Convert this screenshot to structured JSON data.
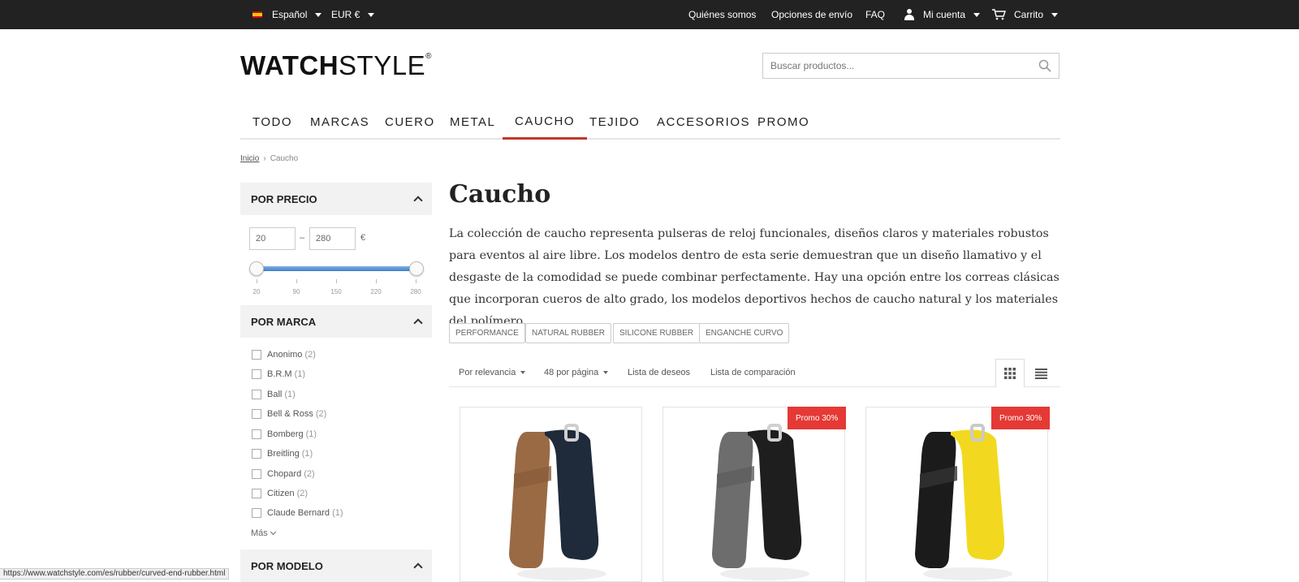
{
  "topbar": {
    "language": "Español",
    "currency": "EUR €",
    "links": [
      "Quiénes somos",
      "Opciones de envío",
      "FAQ"
    ],
    "account": "Mi cuenta",
    "cart": "Carrito"
  },
  "header": {
    "logo_bold": "WATCH",
    "logo_light": "STYLE",
    "logo_mark": "®",
    "search_placeholder": "Buscar productos..."
  },
  "nav": {
    "tabs": [
      "TODO",
      "MARCAS",
      "CUERO",
      "METAL",
      "CAUCHO",
      "TEJIDO",
      "ACCESORIOS",
      "PROMO"
    ],
    "active": "CAUCHO"
  },
  "breadcrumb": {
    "home": "Inicio",
    "separator": "›",
    "current": "Caucho"
  },
  "sidebar": {
    "price": {
      "title": "POR PRECIO",
      "min": "20",
      "max": "280",
      "dash": "–",
      "currency": "€",
      "ticks": [
        "20",
        "90",
        "150",
        "220",
        "280"
      ]
    },
    "brand": {
      "title": "POR MARCA",
      "items": [
        {
          "name": "Anonimo",
          "count": "(2)"
        },
        {
          "name": "B.R.M",
          "count": "(1)"
        },
        {
          "name": "Ball",
          "count": "(1)"
        },
        {
          "name": "Bell & Ross",
          "count": "(2)"
        },
        {
          "name": "Bomberg",
          "count": "(1)"
        },
        {
          "name": "Breitling",
          "count": "(1)"
        },
        {
          "name": "Chopard",
          "count": "(2)"
        },
        {
          "name": "Citizen",
          "count": "(2)"
        },
        {
          "name": "Claude Bernard",
          "count": "(1)"
        }
      ],
      "more": "Más"
    },
    "model": {
      "title": "POR MODELO"
    }
  },
  "main": {
    "title": "Caucho",
    "description": "La colección de caucho representa pulseras de reloj funcionales, diseños claros y materiales robustos para eventos al aire libre. Los modelos dentro de esta serie demuestran que un diseño llamativo y el desgaste de la comodidad se puede combinar perfectamente. Hay una opción entre los correas clásicas que incorporan cueros de alto grado, los modelos deportivos hechos de caucho natural y los materiales del polímero.",
    "tags": [
      "PERFORMANCE",
      "NATURAL RUBBER",
      "SILICONE RUBBER",
      "ENGANCHE CURVO"
    ],
    "toolbar": {
      "sort": "Por relevancia",
      "per_page": "48 por página",
      "wishlist": "Lista de deseos",
      "compare": "Lista de comparación"
    },
    "products": [
      {
        "badge": "",
        "colors": {
          "strap": "#9a6a45",
          "inner": "#1f2a3a",
          "buckle": "#cfcfcf"
        }
      },
      {
        "badge": "Promo 30%",
        "colors": {
          "strap": "#6d6d6d",
          "inner": "#1e1e1e",
          "buckle": "#d0d0d0"
        }
      },
      {
        "badge": "Promo 30%",
        "colors": {
          "strap": "#1b1b1b",
          "inner": "#f2d91f",
          "buckle": "#c9c9c9"
        }
      }
    ]
  },
  "status_url": "https://www.watchstyle.com/es/rubber/curved-end-rubber.html",
  "colors": {
    "accent": "#c0392b",
    "badge": "#e53935",
    "topbar": "#222222"
  }
}
